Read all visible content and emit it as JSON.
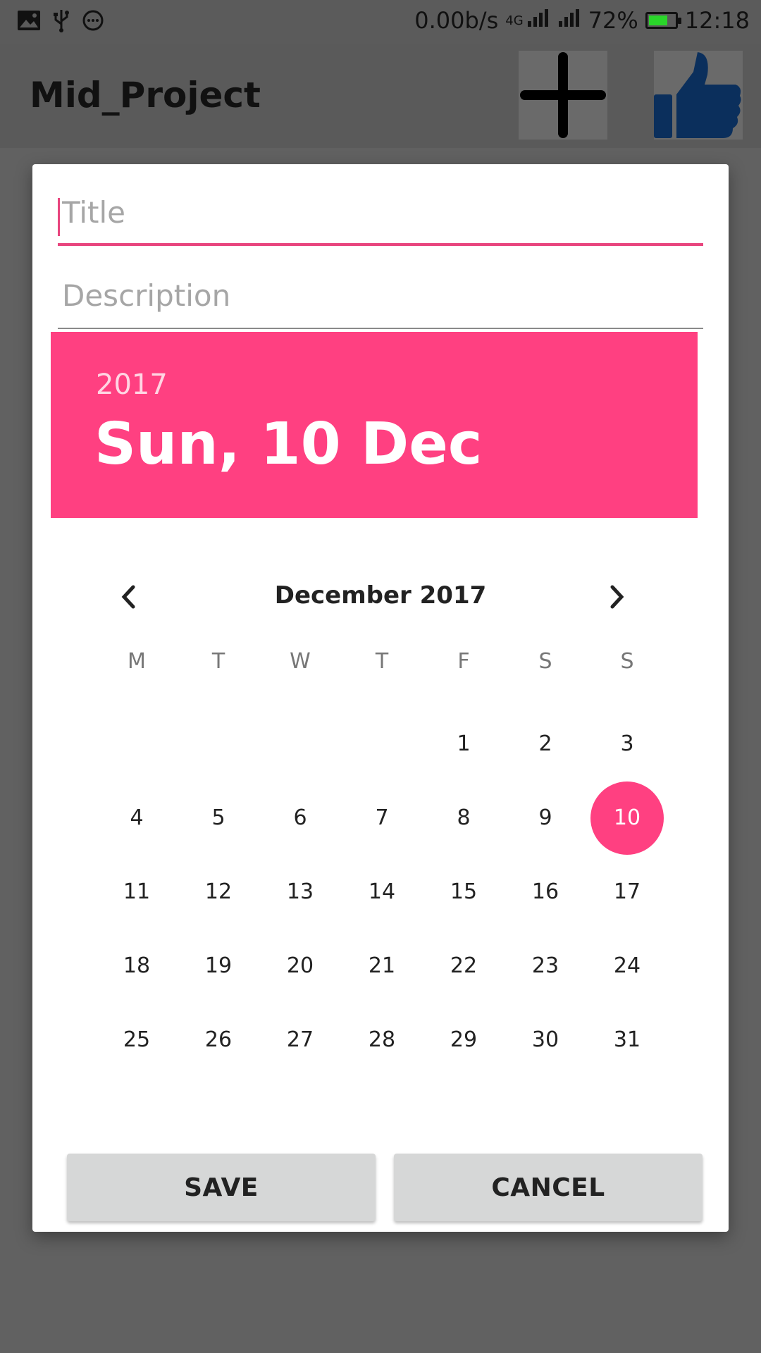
{
  "status_bar": {
    "speed": "0.00b/s",
    "network": "4G",
    "battery": "72%",
    "battery_level": 0.72,
    "battery_color": "#2ad62a",
    "time": "12:18"
  },
  "app_bar": {
    "title": "Mid_Project",
    "buttons": [
      {
        "icon": "plus-icon"
      },
      {
        "icon": "thumbs-up-icon",
        "color": "#0b2f5c"
      }
    ]
  },
  "dialog": {
    "title_field": {
      "value": "",
      "placeholder": "Title"
    },
    "description_field": {
      "value": "",
      "placeholder": "Description"
    },
    "date_header": {
      "year": "2017",
      "selected_date": "Sun, 10 Dec",
      "color": "#ff4081"
    },
    "calendar": {
      "month_label": "December 2017",
      "weekdays": [
        "M",
        "T",
        "W",
        "T",
        "F",
        "S",
        "S"
      ],
      "leading_blanks": 4,
      "days": [
        "1",
        "2",
        "3",
        "4",
        "5",
        "6",
        "7",
        "8",
        "9",
        "10",
        "11",
        "12",
        "13",
        "14",
        "15",
        "16",
        "17",
        "18",
        "19",
        "20",
        "21",
        "22",
        "23",
        "24",
        "25",
        "26",
        "27",
        "28",
        "29",
        "30",
        "31"
      ],
      "selected_day": "10"
    },
    "buttons": {
      "save": "SAVE",
      "cancel": "CANCEL"
    }
  }
}
